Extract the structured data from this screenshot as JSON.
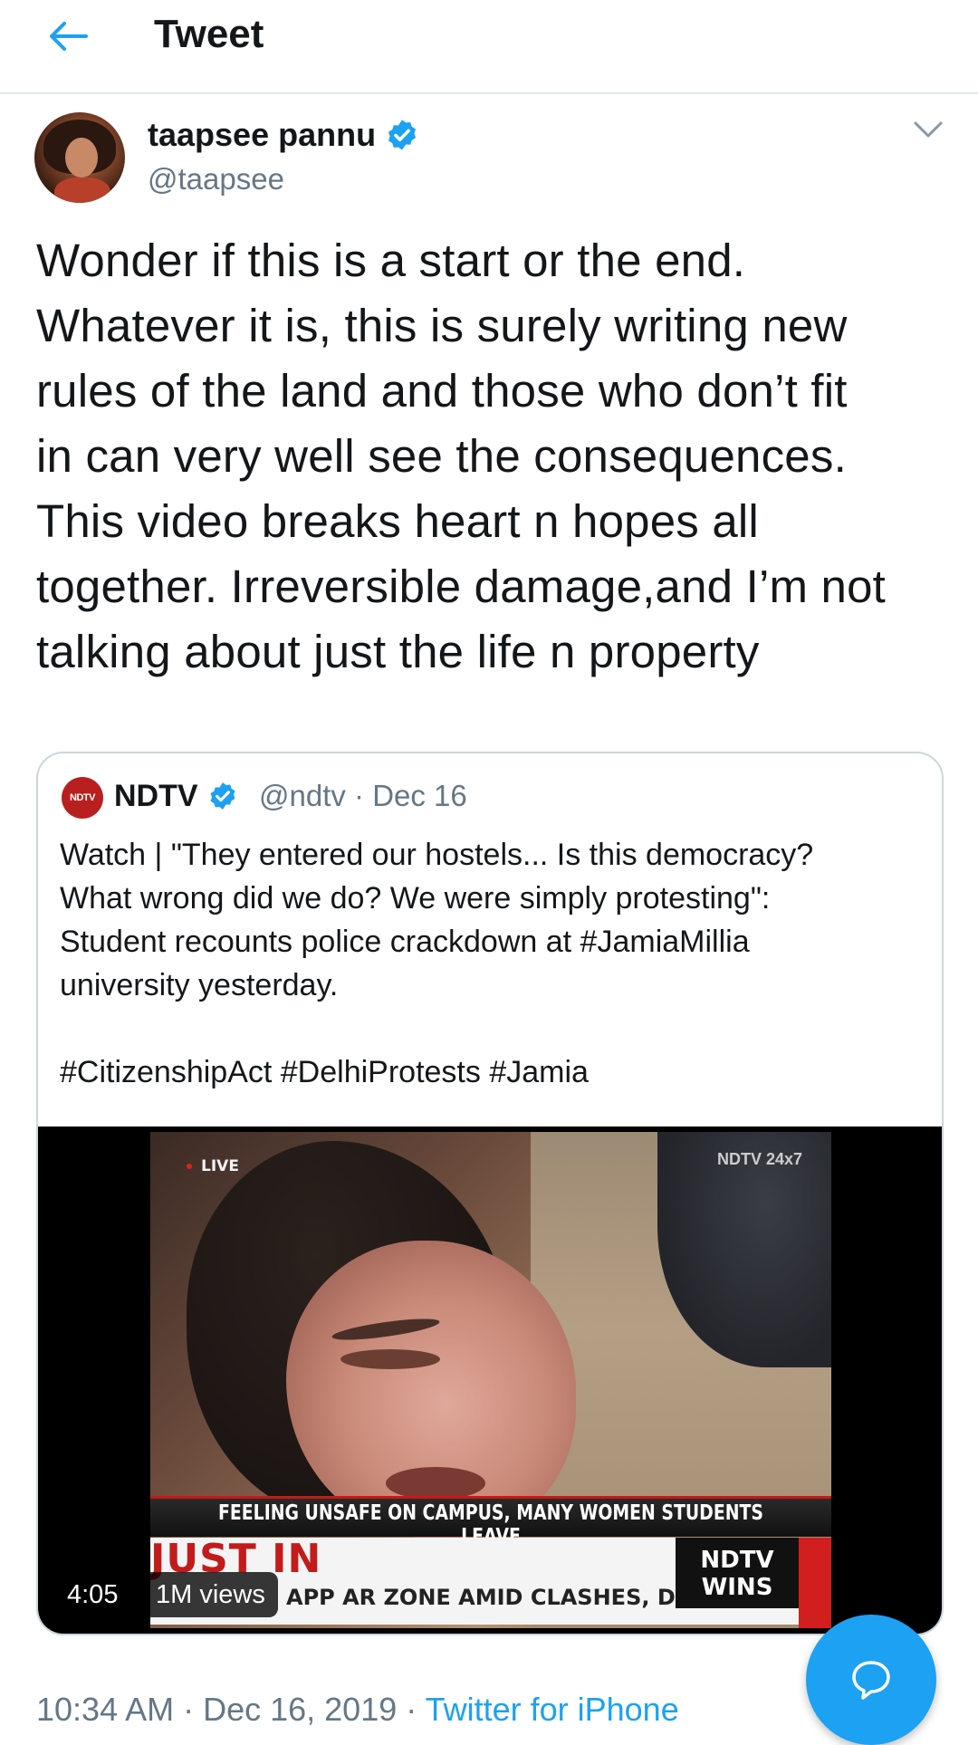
{
  "header": {
    "title": "Tweet"
  },
  "tweet": {
    "author_name": "taapsee pannu",
    "author_handle": "@taapsee",
    "text": "Wonder if this is a start or the end.\nWhatever it is, this is surely writing new\nrules of the land and those who don’t fit\nin can very well see the consequences.\nThis video breaks heart n hopes all\ntogether. Irreversible damage,and I’m not\ntalking about just the life n property",
    "timestamp": "10:34 AM · Dec 16, 2019 · ",
    "source": "Twitter for iPhone"
  },
  "quote": {
    "logo_text": "NDTV",
    "author_name": "NDTV",
    "handle_date": "@ndtv · Dec 16",
    "text": "Watch | \"They entered our hostels... Is this democracy?\nWhat wrong did we do? We were simply protesting\":\nStudent recounts police crackdown at #JamiaMillia\n university yesterday.\n\n#CitizenshipAct #DelhiProtests #Jamia"
  },
  "video": {
    "live_label": "LIVE",
    "channel_bug": "NDTV 24x7",
    "ticker": "FEELING UNSAFE ON CAMPUS, MANY WOMEN STUDENTS LEAVE",
    "banner": "JUST IN",
    "crawl": "APP AR ZONE AMID CLASHES, DETAIL",
    "ndtv_wins": "NDTV WINS",
    "duration": "4:05",
    "views": "1M views"
  },
  "colors": {
    "accent": "#1da1f2",
    "text": "#14171a",
    "muted": "#657786",
    "border": "#ccd6dd"
  },
  "icons": {
    "back": "arrow-left-icon",
    "verified": "verified-badge-icon",
    "caret": "chevron-down-icon",
    "compose_reply": "speech-bubble-icon"
  }
}
